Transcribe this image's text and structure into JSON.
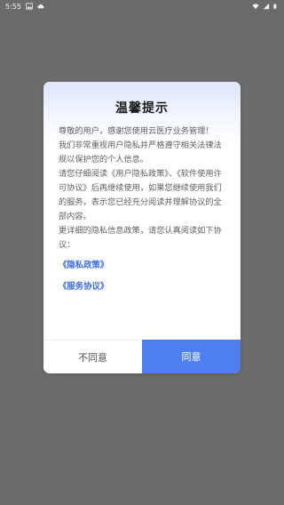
{
  "status_bar": {
    "time": "5:55",
    "icons": [
      "image-icon",
      "cloud-icon",
      "signal-icon",
      "wifi-icon",
      "battery-icon"
    ]
  },
  "dialog": {
    "title": "温馨提示",
    "paragraphs": [
      "尊敬的用户，感谢您使用云医疗业务管理！",
      "我们非常重视用户隐私并严格遵守相关法律法规以保护您的个人信息。",
      "请您仔细阅读《用户隐私政策》、《软件使用许可协议》后再继续使用，如果您继续使用我们的服务，表示您已经充分阅读并理解协议的全部内容。",
      "更详细的隐私信息政策，请您认真阅读如下协议："
    ],
    "links": {
      "privacy": "《隐私政策》",
      "service": "《服务协议》"
    },
    "buttons": {
      "disagree": "不同意",
      "agree": "同意"
    }
  },
  "colors": {
    "accent": "#4f7ef2",
    "link": "#3d6ce2",
    "overlay": "#6b6b6b"
  }
}
